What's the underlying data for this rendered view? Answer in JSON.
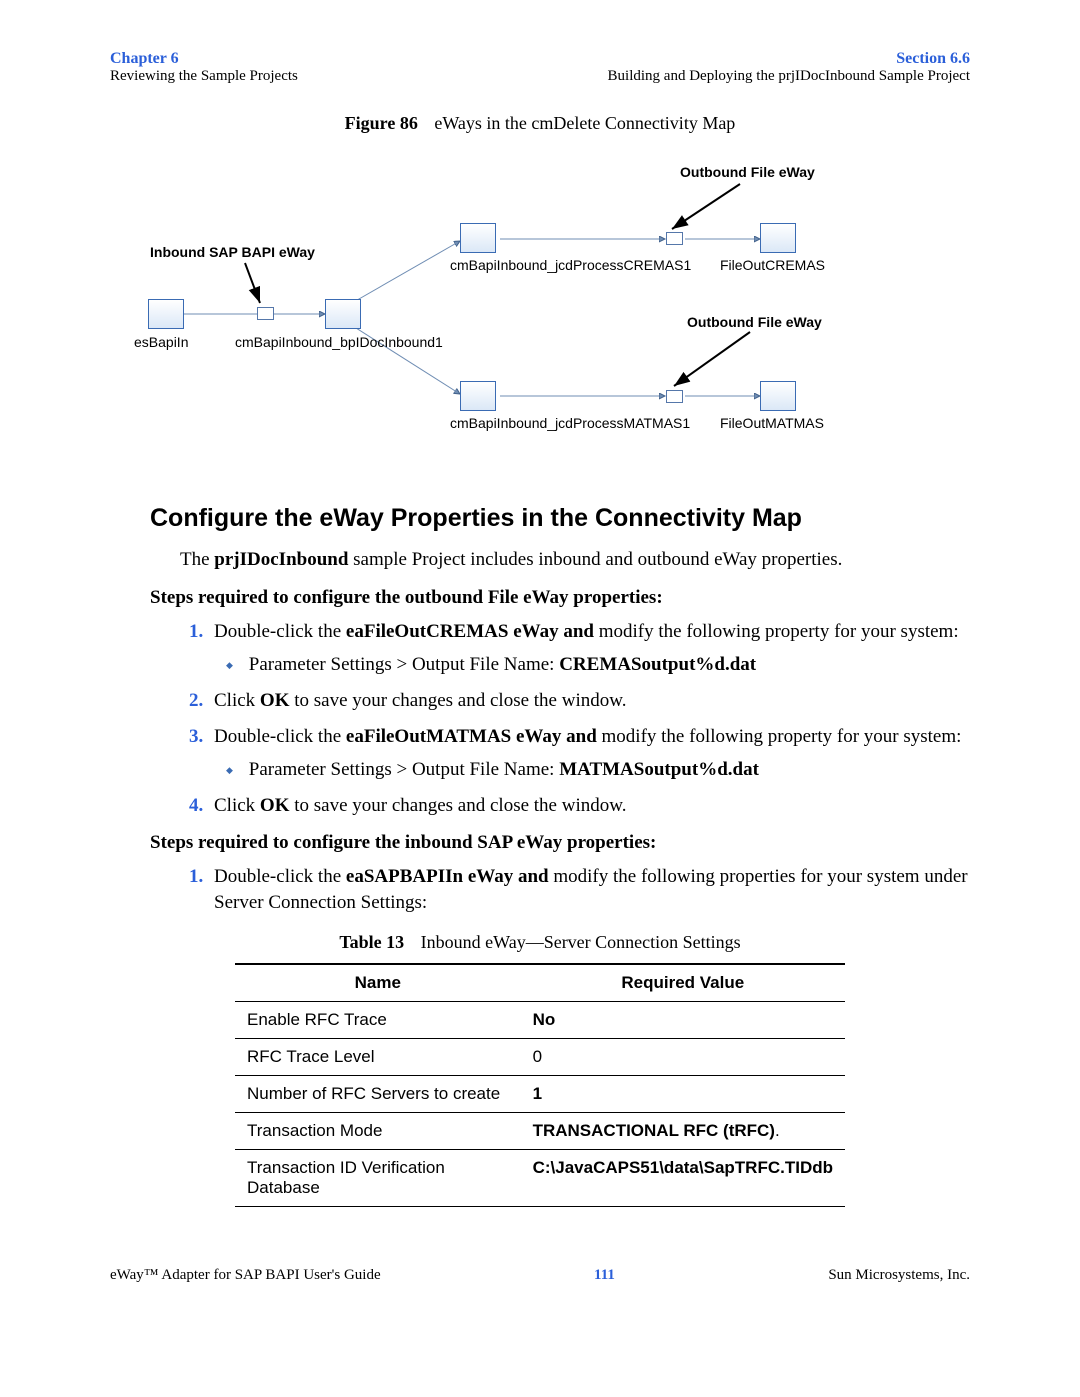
{
  "header": {
    "chapter": "Chapter 6",
    "subleft": "Reviewing the Sample Projects",
    "section": "Section 6.6",
    "subright": "Building and Deploying the prjIDocInbound Sample Project"
  },
  "figure": {
    "label": "Figure 86",
    "caption": "eWays in the cmDelete Connectivity Map",
    "labels": {
      "outbound1": "Outbound File eWay",
      "outbound2": "Outbound File eWay",
      "inbound": "Inbound SAP BAPI eWay"
    },
    "components": {
      "esBapiIn": "esBapiIn",
      "bpl": "cmBapiInbound_bpIDocInbound1",
      "jcdCremas": "cmBapiInbound_jcdProcessCREMAS1",
      "jcdMatmas": "cmBapiInbound_jcdProcessMATMAS1",
      "fileCremas": "FileOutCREMAS",
      "fileMatmas": "FileOutMATMAS"
    }
  },
  "section_title": "Configure the eWay Properties in the Connectivity Map",
  "intro": {
    "pre": "The ",
    "bold": "prjIDocInbound",
    "post": " sample Project includes inbound and outbound eWay properties."
  },
  "outbound": {
    "heading": "Steps required to configure the outbound File eWay properties:",
    "steps": [
      {
        "pre": "Double-click the ",
        "bold": "eaFileOutCREMAS eWay and",
        "post": " modify the following property for your system:",
        "sub": {
          "pre": "Parameter Settings > Output File Name: ",
          "bold": "CREMASoutput%d.dat"
        }
      },
      {
        "pre": "Click ",
        "bold": "OK",
        "post": " to save your changes and close the window."
      },
      {
        "pre": "Double-click the ",
        "bold": "eaFileOutMATMAS eWay and",
        "post": " modify the following property for your system:",
        "sub": {
          "pre": "Parameter Settings > Output File Name: ",
          "bold": "MATMASoutput%d.dat"
        }
      },
      {
        "pre": "Click ",
        "bold": "OK",
        "post": " to save your changes and close the window."
      }
    ]
  },
  "inbound": {
    "heading": "Steps required to configure the inbound SAP eWay properties:",
    "step1": {
      "pre": "Double-click the ",
      "bold": "eaSAPBAPIIn eWay and",
      "post": " modify the following properties for your system under Server Connection Settings:"
    }
  },
  "table": {
    "label": "Table 13",
    "caption": "Inbound eWay—Server Connection Settings",
    "cols": {
      "name": "Name",
      "value": "Required Value"
    },
    "rows": [
      {
        "name": "Enable RFC Trace",
        "value": "No",
        "bold": true
      },
      {
        "name": "RFC Trace Level",
        "value": "0",
        "bold": false
      },
      {
        "name": "Number of RFC Servers to create",
        "value": "1",
        "bold": true
      },
      {
        "name": "Transaction Mode",
        "value": "TRANSACTIONAL RFC (tRFC)",
        "bold": true,
        "suffix": "."
      },
      {
        "name": "Transaction ID Verification Database",
        "value": "C:\\JavaCAPS51\\data\\SapTRFC.TIDdb",
        "bold": true
      }
    ]
  },
  "footer": {
    "left": "eWay™ Adapter for SAP BAPI User's Guide",
    "page": "111",
    "right": "Sun Microsystems, Inc."
  }
}
